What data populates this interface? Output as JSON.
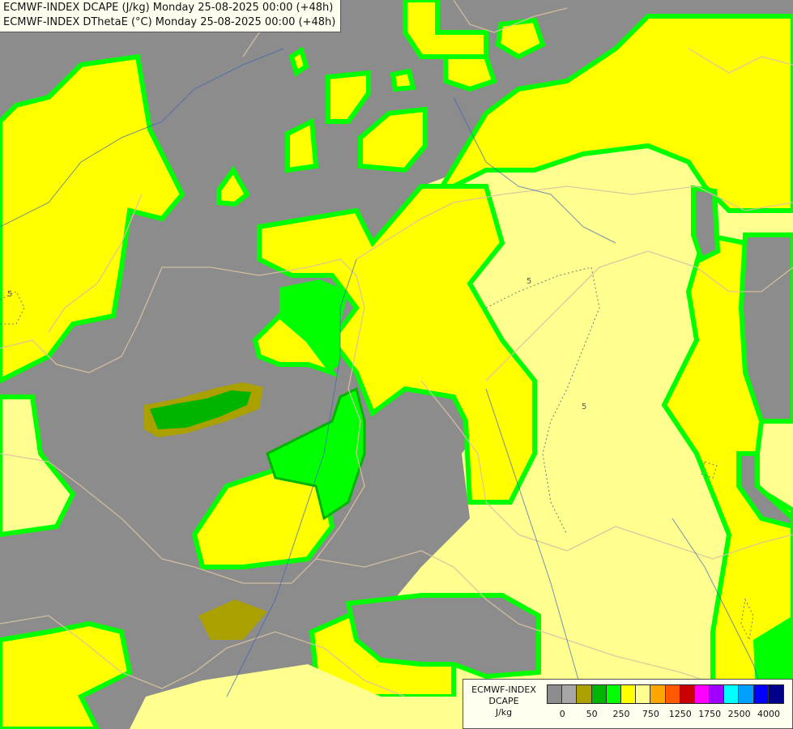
{
  "titles": {
    "line1": "ECMWF-INDEX DCAPE (J/kg) Monday 25-08-2025 00:00 (+48h)",
    "line2": "ECMWF-INDEX DThetaE (°C) Monday 25-08-2025 00:00 (+48h)"
  },
  "legend": {
    "name_line1": "ECMWF-INDEX",
    "name_line2": "DCAPE",
    "unit": "J/kg",
    "colors": [
      "#8c8c8c",
      "#a6a6a6",
      "#aaa000",
      "#00b400",
      "#00ff00",
      "#ffff00",
      "#ffff90",
      "#ffa500",
      "#ff5a00",
      "#c80000",
      "#ff00ff",
      "#a000ff",
      "#00ffff",
      "#00a0ff",
      "#0000ff",
      "#00008b"
    ],
    "tick_labels": [
      "0",
      "50",
      "250",
      "750",
      "1250",
      "1750",
      "2500",
      "4000"
    ]
  },
  "contour_labels": [
    "5",
    "5",
    "5"
  ]
}
